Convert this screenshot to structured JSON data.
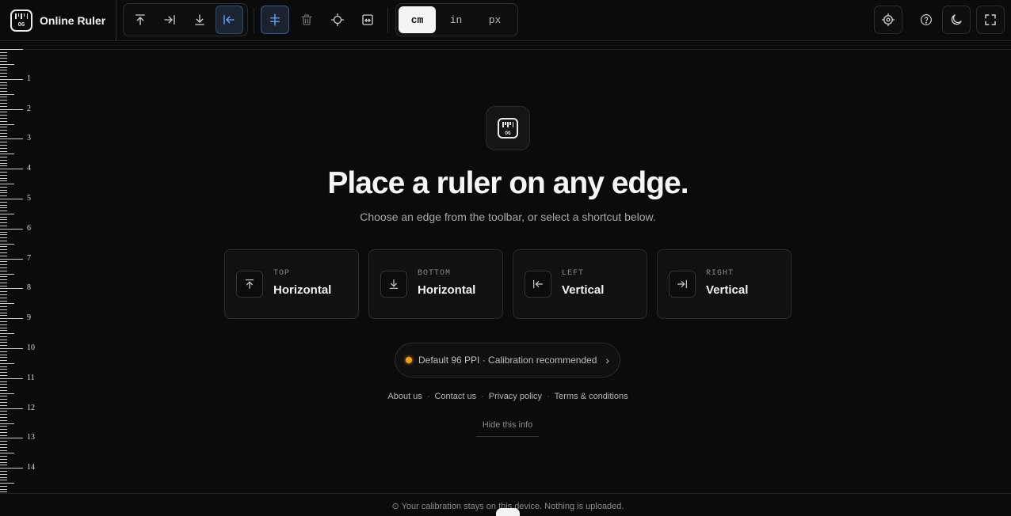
{
  "app": {
    "name": "Online Ruler",
    "logo_text": "OG"
  },
  "toolbar": {
    "edge_buttons": [
      {
        "name": "top-edge",
        "icon": "arrow-up-to-line-icon",
        "active": false
      },
      {
        "name": "right-edge",
        "icon": "arrow-right-to-line-icon",
        "active": false
      },
      {
        "name": "bottom-edge",
        "icon": "arrow-down-to-line-icon",
        "active": false
      },
      {
        "name": "left-edge",
        "icon": "arrow-left-to-line-icon",
        "active": true
      }
    ],
    "tool_buttons": [
      {
        "name": "guide",
        "icon": "split-vertical-icon",
        "active": true
      },
      {
        "name": "delete",
        "icon": "trash-icon",
        "disabled": true
      },
      {
        "name": "crosshair",
        "icon": "crosshair-icon"
      },
      {
        "name": "measure",
        "icon": "measure-box-icon"
      }
    ],
    "units": [
      "cm",
      "in",
      "px"
    ],
    "active_unit": "cm",
    "right_buttons": [
      "target-icon",
      "help-icon",
      "moon-icon",
      "fullscreen-icon"
    ]
  },
  "ruler": {
    "labels": [
      "1",
      "2",
      "3",
      "4",
      "5",
      "6",
      "7",
      "8",
      "9",
      "10",
      "11",
      "12",
      "13",
      "14"
    ]
  },
  "hero": {
    "headline": "Place a ruler on any edge.",
    "subline": "Choose an edge from the toolbar, or select a shortcut below."
  },
  "shortcuts": [
    {
      "small": "TOP",
      "big": "Horizontal",
      "icon": "arrow-up-to-line-icon"
    },
    {
      "small": "BOTTOM",
      "big": "Horizontal",
      "icon": "arrow-down-to-line-icon"
    },
    {
      "small": "LEFT",
      "big": "Vertical",
      "icon": "arrow-left-to-line-icon"
    },
    {
      "small": "RIGHT",
      "big": "Vertical",
      "icon": "arrow-right-to-line-icon"
    }
  ],
  "calibration": {
    "text": "Default 96 PPI · Calibration recommended",
    "status_color": "#f0a020"
  },
  "links": [
    "About us",
    "Contact us",
    "Privacy policy",
    "Terms & conditions"
  ],
  "hide_label": "Hide this info",
  "footer": {
    "text": "⊙ Your calibration stays on this device. Nothing is uploaded."
  }
}
